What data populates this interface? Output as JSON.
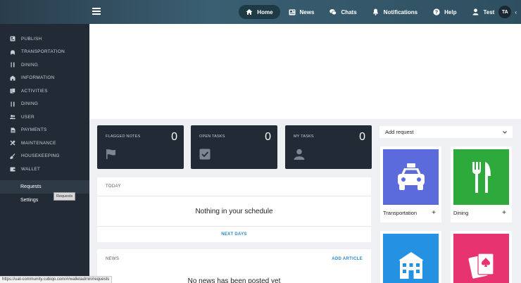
{
  "topbar": {
    "nav": [
      {
        "label": "Home",
        "icon": "home-icon",
        "active": true
      },
      {
        "label": "News",
        "icon": "newspaper-icon"
      },
      {
        "label": "Chats",
        "icon": "chat-icon"
      },
      {
        "label": "Notifications",
        "icon": "bell-icon"
      },
      {
        "label": "Help",
        "icon": "help-icon"
      },
      {
        "label": "Test",
        "icon": "user-icon"
      }
    ],
    "avatar": "TA",
    "collapse": "‹"
  },
  "sidebar": {
    "items": [
      {
        "label": "PUBLISH",
        "icon": "newspaper-icon"
      },
      {
        "label": "TRANSPORTATION",
        "icon": "car-icon"
      },
      {
        "label": "DINING",
        "icon": "utensils-icon"
      },
      {
        "label": "INFORMATION",
        "icon": "building-icon"
      },
      {
        "label": "ACTIVITIES",
        "icon": "cards-icon"
      },
      {
        "label": "DINING",
        "icon": "utensils-icon"
      },
      {
        "label": "USER",
        "icon": "users-icon"
      },
      {
        "label": "PAYMENTS",
        "icon": "document-icon"
      },
      {
        "label": "MAINTENANCE",
        "icon": "tools-icon"
      },
      {
        "label": "HOUSEKEEPING",
        "icon": "broom-icon"
      },
      {
        "label": "WALLET",
        "icon": "wallet-icon"
      }
    ],
    "sub": [
      {
        "label": "Requests",
        "active": true
      },
      {
        "label": "Settings"
      }
    ],
    "tooltip": "Requests"
  },
  "stats": [
    {
      "label": "FLAGGED NOTES",
      "value": "0",
      "icon": "flag-icon"
    },
    {
      "label": "OPEN TASKS",
      "value": "0",
      "icon": "checkbox-icon"
    },
    {
      "label": "MY TASKS",
      "value": "0",
      "icon": "person-icon"
    }
  ],
  "today": {
    "title": "TODAY",
    "empty": "Nothing in your schedule",
    "link": "NEXT DAYS"
  },
  "news": {
    "title": "NEWS",
    "link": "ADD ARTICLE",
    "empty": "No news has been posted yet"
  },
  "request_select": {
    "value": "Add request"
  },
  "tiles": [
    {
      "label": "Transportation",
      "color": "#5b6bdc",
      "icon": "taxi-icon"
    },
    {
      "label": "Dining",
      "color": "#2eaa3d",
      "icon": "utensils-icon"
    },
    {
      "label": "",
      "color": "#2491e3",
      "icon": "building-icon"
    },
    {
      "label": "",
      "color": "#e7336f",
      "icon": "cards-icon"
    }
  ],
  "statusbar": "https://uat-community.cubiqo.com/#/walletadmin/requests"
}
